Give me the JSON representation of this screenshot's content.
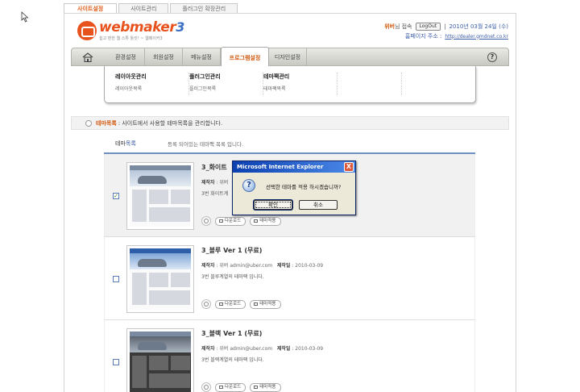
{
  "top_tabs": [
    {
      "label": "사이트설정",
      "active": true
    },
    {
      "label": "사이트관리",
      "active": false
    },
    {
      "label": "플러그인 확장관리",
      "active": false
    }
  ],
  "logo": {
    "word": "webmaker",
    "version": "3",
    "tagline": "쉽고 편한 웹 스튜 툴킷! ~ 웹메이커3"
  },
  "header": {
    "user": "위버",
    "connected_suffix": "님 접속",
    "logout": "LogOut",
    "date": "2010년 03월 24일 (수)",
    "homepage_label": "홈페이지 주소 :",
    "homepage_url": "http://dealer.gmdnet.co.kr"
  },
  "nav": {
    "items": [
      {
        "label": "환경설정",
        "active": false
      },
      {
        "label": "회원설정",
        "active": false
      },
      {
        "label": "메뉴설정",
        "active": false
      },
      {
        "label": "프로그램설정",
        "active": true
      },
      {
        "label": "디자인설정",
        "active": false
      }
    ],
    "help": "?"
  },
  "submenu": [
    {
      "title": "레이아웃관리",
      "link": "레이아웃목록"
    },
    {
      "title": "플러그인관리",
      "link": "플러그인목록"
    },
    {
      "title": "테마팩관리",
      "link": "테마팩목록"
    }
  ],
  "infobar": {
    "title": "테마목록",
    "text": ": 사이트에서 사용할 테마목록을 관리합니다."
  },
  "section": {
    "title_a": "테마",
    "title_b": "목록",
    "desc": "등록 되어있는 테마팩 목록 입니다."
  },
  "themes": [
    {
      "name": "3_화이트",
      "author_label": "제작자",
      "author": ": 위버",
      "date_label": "",
      "date": "",
      "desc": "3번 화이트계",
      "checked": "✓",
      "download": "다운로드",
      "apply": "테마적용"
    },
    {
      "name": "3_블루 Ver 1 (무료)",
      "author_label": "제작자",
      "author": ": 위버 admin@uber.com",
      "date_label": "제작일",
      "date": ": 2010-03-09",
      "desc": "3번 블루계열의 테마팩 입니다.",
      "checked": "",
      "download": "다운로드",
      "apply": "테마적용"
    },
    {
      "name": "3_블랙 Ver 1 (무료)",
      "author_label": "제작자",
      "author": ": 위버 admin@uber.com",
      "date_label": "제작일",
      "date": ": 2010-03-09",
      "desc": "3번 블랙계열의 테마팩 입니다.",
      "checked": "",
      "download": "다운로드",
      "apply": "테마적용"
    }
  ],
  "dialog": {
    "title": "Microsoft Internet Explorer",
    "close": "X",
    "icon": "?",
    "message": "선택한 테마를 적용 하시겠습니까?",
    "ok": "확인",
    "cancel": "취소"
  },
  "colors": {
    "accent": "#e0601c",
    "link": "#3b5da8",
    "dialog_title": "#0a3fb0"
  }
}
